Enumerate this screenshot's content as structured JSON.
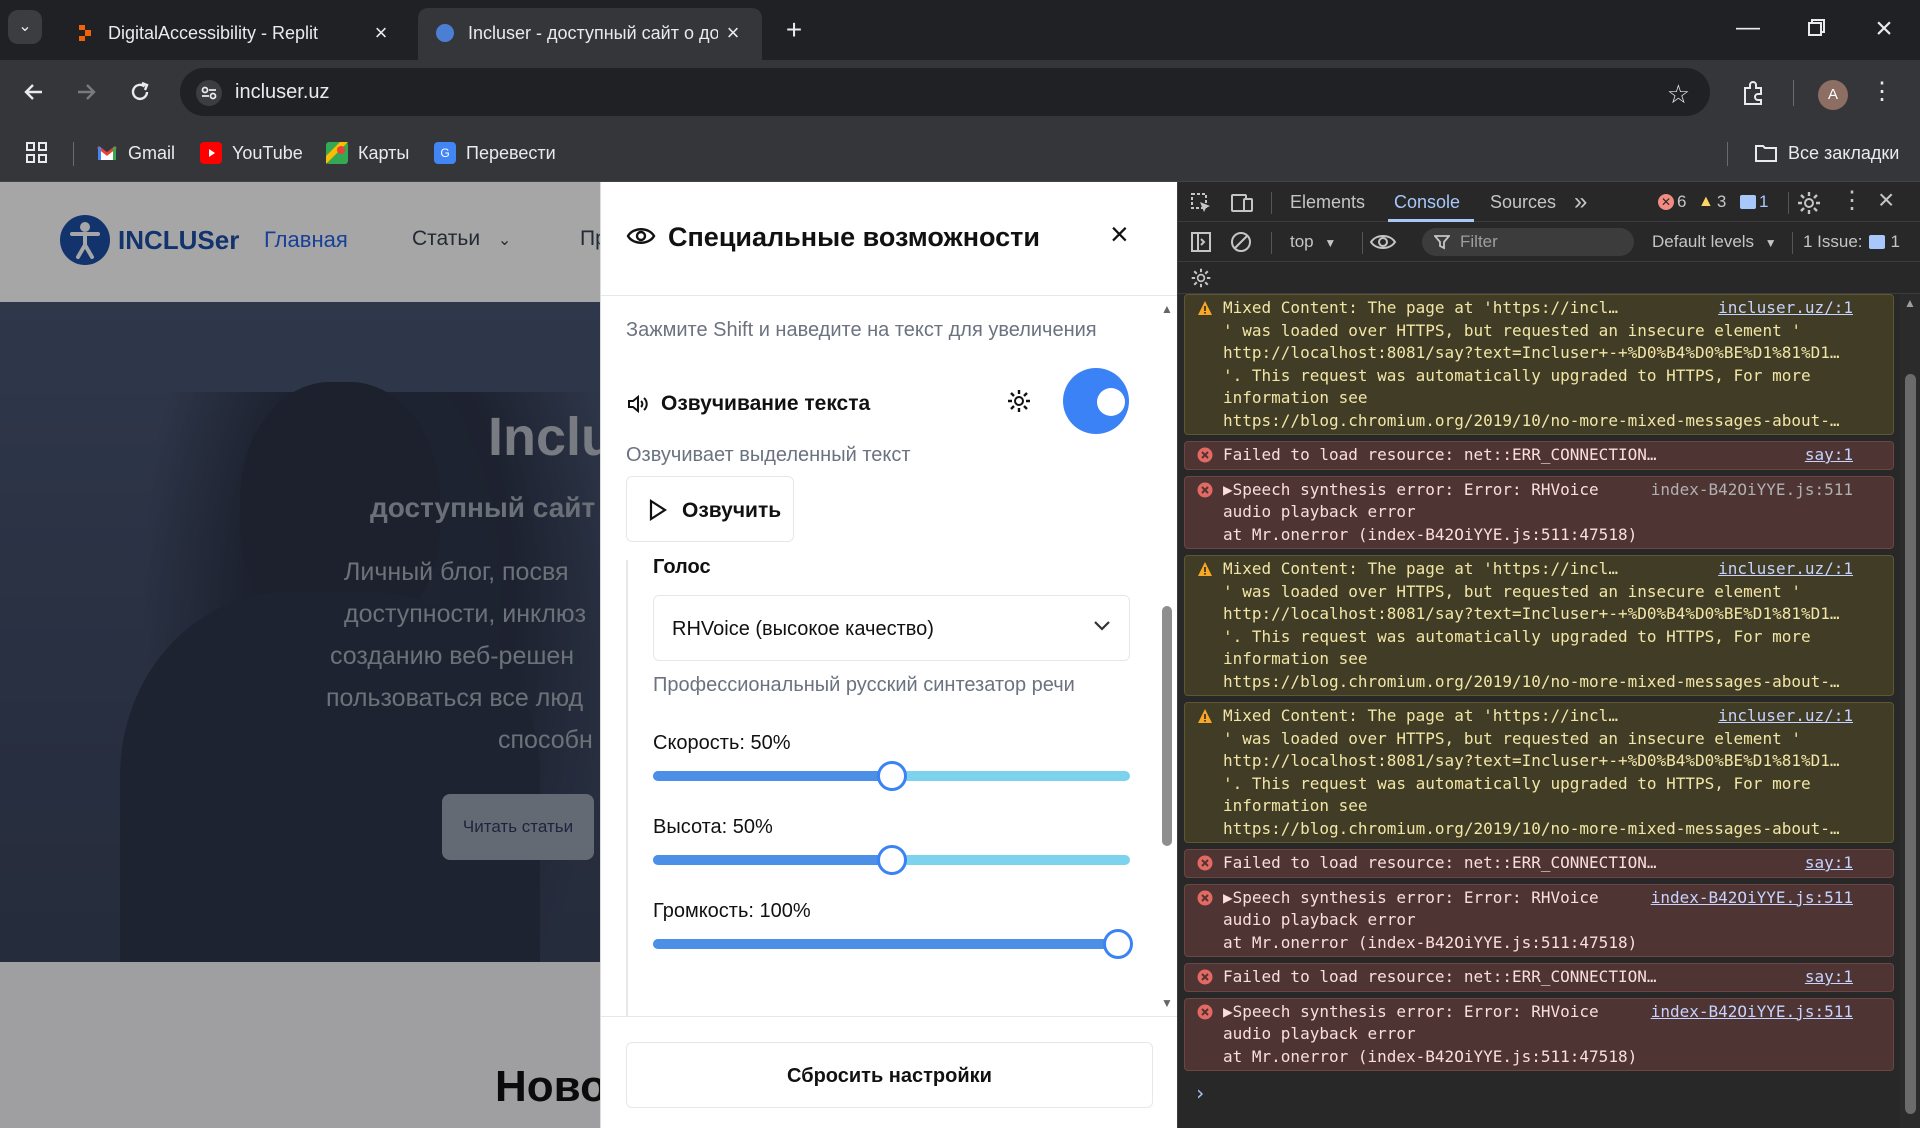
{
  "browser": {
    "tabs": [
      {
        "title": "DigitalAccessibility - Replit",
        "active": false
      },
      {
        "title": "Incluser - доступный сайт о до",
        "active": true
      }
    ],
    "url": "incluser.uz",
    "profile_initial": "A",
    "bookmarks": [
      {
        "label": "Gmail"
      },
      {
        "label": "YouTube"
      },
      {
        "label": "Карты"
      },
      {
        "label": "Перевести"
      }
    ],
    "all_bookmarks": "Все закладки"
  },
  "site": {
    "logo_text": "INCLUSer",
    "nav": {
      "home": "Главная",
      "articles": "Статьи",
      "more": "Пр"
    },
    "hero": {
      "title": "Inclu",
      "subtitle": "доступный сайт",
      "lines": [
        "Личный блог, посвя",
        "доступности, инклюз",
        "созданию веб-решен",
        "пользоваться все люд",
        "способн"
      ],
      "button": "Читать статьи"
    },
    "section_title": "Ново"
  },
  "a11y": {
    "title": "Специальные возможности",
    "hint": "Зажмите Shift и наведите на текст для увеличения",
    "tts_label": "Озвучивание текста",
    "tts_enabled": true,
    "tts_desc": "Озвучивает выделенный текст",
    "speak_button": "Озвучить",
    "voice_label": "Голос",
    "voice_value": "RHVoice (высокое качество)",
    "voice_desc": "Профессиональный русский синтезатор речи",
    "speed_label": "Скорость: 50%",
    "speed_value": 0.5,
    "pitch_label": "Высота: 50%",
    "pitch_value": 0.5,
    "volume_label": "Громкость: 100%",
    "volume_value": 1.0,
    "reset_button": "Сбросить настройки"
  },
  "devtools": {
    "tabs": [
      "Elements",
      "Console",
      "Sources"
    ],
    "active_tab": "Console",
    "errors_count": "6",
    "warnings_count": "3",
    "info_count": "1",
    "context": "top",
    "filter_placeholder": "Filter",
    "levels": "Default levels",
    "issues_label": "1 Issue:",
    "issues_count": "1",
    "messages": [
      {
        "type": "warn",
        "source": "incluser.uz/:1",
        "lines": [
          "Mixed Content: The page at 'https://incluser.uz/",
          "' was loaded over HTTPS, but requested an insecure element '",
          "http://localhost:8081/say?text=Incluser+-+%D0%B4%D0%BE%D1%81%D1…",
          "'. This request was automatically upgraded to HTTPS, For more",
          "information see",
          "https://blog.chromium.org/2019/10/no-more-mixed-messages-about-…"
        ]
      },
      {
        "type": "err",
        "source": "say:1",
        "lines": [
          "Failed to load resource: net::ERR_CONNECTION_REFUSED"
        ]
      },
      {
        "type": "err",
        "source": "index-B42OiYYE.js:511",
        "source_plain": true,
        "lines": [
          "▶Speech synthesis error: Error: RHVoice",
          "audio playback error",
          "    at Mr.onerror (index-B42OiYYE.js:511:47518)"
        ]
      },
      {
        "type": "warn",
        "source": "incluser.uz/:1",
        "lines": [
          "Mixed Content: The page at 'https://incluser.uz/",
          "' was loaded over HTTPS, but requested an insecure element '",
          "http://localhost:8081/say?text=Incluser+-+%D0%B4%D0%BE%D1%81%D1…",
          "'. This request was automatically upgraded to HTTPS, For more",
          "information see",
          "https://blog.chromium.org/2019/10/no-more-mixed-messages-about-…"
        ]
      },
      {
        "type": "warn",
        "source": "incluser.uz/:1",
        "lines": [
          "Mixed Content: The page at 'https://incluser.uz/",
          "' was loaded over HTTPS, but requested an insecure element '",
          "http://localhost:8081/say?text=Incluser+-+%D0%B4%D0%BE%D1%81%D1…",
          "'. This request was automatically upgraded to HTTPS, For more",
          "information see",
          "https://blog.chromium.org/2019/10/no-more-mixed-messages-about-…"
        ]
      },
      {
        "type": "err",
        "source": "say:1",
        "lines": [
          "Failed to load resource: net::ERR_CONNECTION_REFUSED"
        ]
      },
      {
        "type": "err",
        "source": "index-B42OiYYE.js:511",
        "lines": [
          "▶Speech synthesis error: Error: RHVoice",
          "audio playback error",
          "    at Mr.onerror (index-B42OiYYE.js:511:47518)"
        ]
      },
      {
        "type": "err",
        "source": "say:1",
        "lines": [
          "Failed to load resource: net::ERR_CONNECTION_REFUSED"
        ]
      },
      {
        "type": "err",
        "source": "index-B42OiYYE.js:511",
        "lines": [
          "▶Speech synthesis error: Error: RHVoice",
          "audio playback error",
          "    at Mr.onerror (index-B42OiYYE.js:511:47518)"
        ]
      }
    ],
    "prompt": "›"
  }
}
